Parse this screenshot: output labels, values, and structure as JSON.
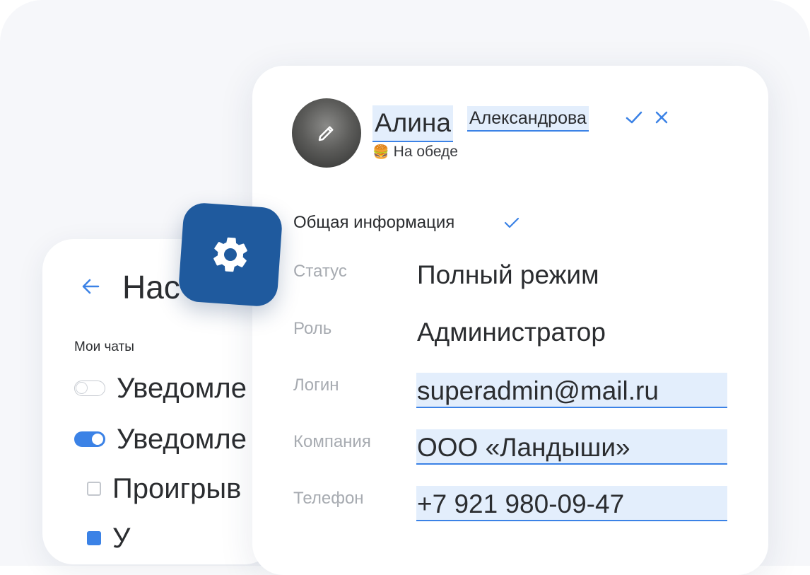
{
  "settings": {
    "title": "Нас",
    "section_label": "Мои чаты",
    "options": [
      {
        "label": "Уведомле",
        "control": "toggle",
        "state": "off"
      },
      {
        "label": "Уведомле",
        "control": "toggle",
        "state": "on"
      },
      {
        "label": "Проигрыв",
        "control": "checkbox",
        "state": "unchecked"
      },
      {
        "label": "У",
        "control": "checkbox",
        "state": "checked"
      }
    ]
  },
  "profile": {
    "first_name": "Алина",
    "last_name": "Александрова",
    "status_emoji": "🍔",
    "status_text": "На обеде",
    "section_title": "Общая информация",
    "fields": {
      "status": {
        "label": "Статус",
        "value": "Полный режим"
      },
      "role": {
        "label": "Роль",
        "value": "Администратор"
      },
      "login": {
        "label": "Логин",
        "value": "superadmin@mail.ru"
      },
      "company": {
        "label": "Компания",
        "value": "ООО «Ландыши»"
      },
      "phone": {
        "label": "Телефон",
        "value": "+7 921 980-09-47"
      }
    }
  },
  "icons": [
    "arrow-left-icon",
    "gear-icon",
    "pencil-icon",
    "check-icon",
    "close-icon"
  ],
  "colors": {
    "accent": "#3b82e6",
    "badge": "#1f5a9e",
    "field_highlight": "#e3eefc",
    "label_gray": "#a7abb1",
    "text": "#2b2d30",
    "background": "#f6f7fa"
  }
}
